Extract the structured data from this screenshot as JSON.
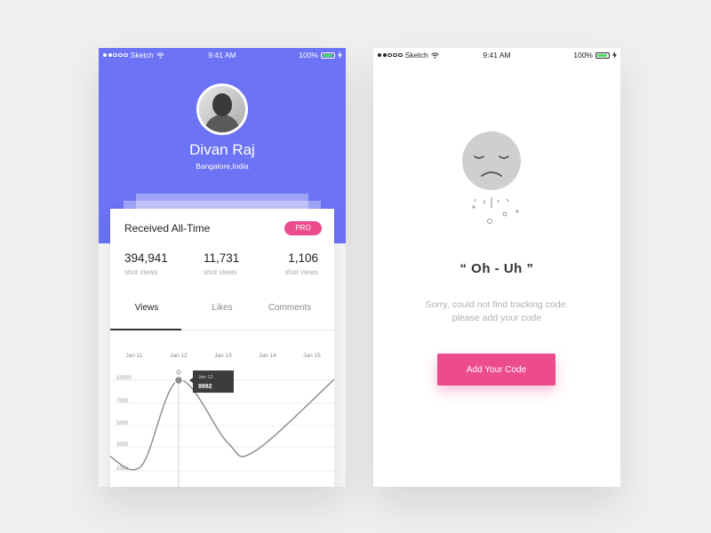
{
  "colors": {
    "brand": "#6c73f4",
    "accent": "#ec4c8c",
    "line": "#8a8a8a",
    "tooltip_bg": "#3c3c3c"
  },
  "status_bar": {
    "carrier": "Sketch",
    "time": "9:41 AM",
    "battery": "100%"
  },
  "profile": {
    "name": "Divan Raj",
    "location": "Bangalore,India"
  },
  "card": {
    "title": "Received All-Time",
    "badge": "PRO",
    "stats": [
      {
        "value": "394,941",
        "label": "shot views"
      },
      {
        "value": "11,731",
        "label": "shot views"
      },
      {
        "value": "1,106",
        "label": "shot views"
      }
    ],
    "tabs": [
      "Views",
      "Likes",
      "Comments"
    ],
    "active_tab": "Views"
  },
  "chart_data": {
    "type": "line",
    "x": [
      "Jan 11",
      "Jan 12",
      "Jan 13",
      "Jan 14",
      "Jan 15"
    ],
    "yticks": [
      10000,
      7000,
      5000,
      3000,
      1000
    ],
    "series": [
      {
        "values": [
          2300,
          9992,
          3400,
          2600,
          10100
        ]
      }
    ],
    "tooltip": {
      "date": "Jan 12",
      "value": "9992"
    }
  },
  "empty_state": {
    "heading": "“ Oh - Uh ”",
    "message_line1": "Sorry, could not find tracking code.",
    "message_line2": "please add your code",
    "button": "Add Your Code"
  }
}
